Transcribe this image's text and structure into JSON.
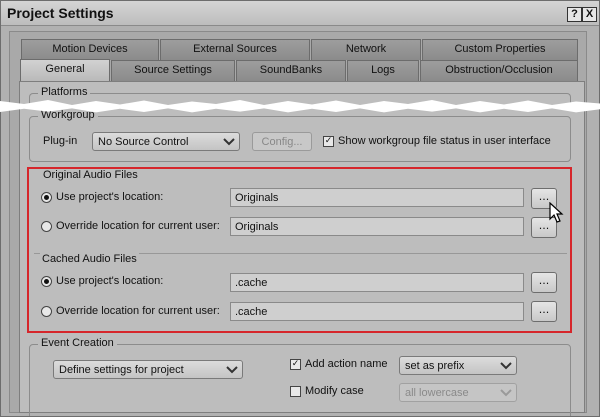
{
  "window": {
    "title": "Project Settings",
    "help_label": "?",
    "close_label": "X"
  },
  "tabs_row1": [
    "Motion Devices",
    "External Sources",
    "Network",
    "Custom Properties"
  ],
  "tabs_row2": [
    "General",
    "Source Settings",
    "SoundBanks",
    "Logs",
    "Obstruction/Occlusion"
  ],
  "platforms": {
    "label": "Platforms"
  },
  "workgroup": {
    "label": "Workgroup",
    "plugin_label": "Plug-in",
    "plugin_value": "No Source Control",
    "config_label": "Config...",
    "show_status_label": "Show workgroup file status in user interface",
    "show_status_checked": true
  },
  "original_audio": {
    "label": "Original Audio Files",
    "use_project_label": "Use project's location:",
    "use_project_value": "Originals",
    "override_label": "Override location for current user:",
    "override_value": "Originals",
    "browse_label": "..."
  },
  "cached_audio": {
    "label": "Cached Audio Files",
    "use_project_label": "Use project's location:",
    "use_project_value": ".cache",
    "override_label": "Override location for current user:",
    "override_value": ".cache",
    "browse_label": "..."
  },
  "event_creation": {
    "label": "Event Creation",
    "define_value": "Define settings for project",
    "add_action_label": "Add action name",
    "add_action_checked": true,
    "add_action_value": "set as prefix",
    "modify_case_label": "Modify case",
    "modify_case_checked": false,
    "modify_case_value": "all lowercase"
  },
  "colors": {
    "highlight": "#d6262b",
    "window_bg": "#b1b1b1",
    "pane_bg": "#bdbdbd"
  }
}
